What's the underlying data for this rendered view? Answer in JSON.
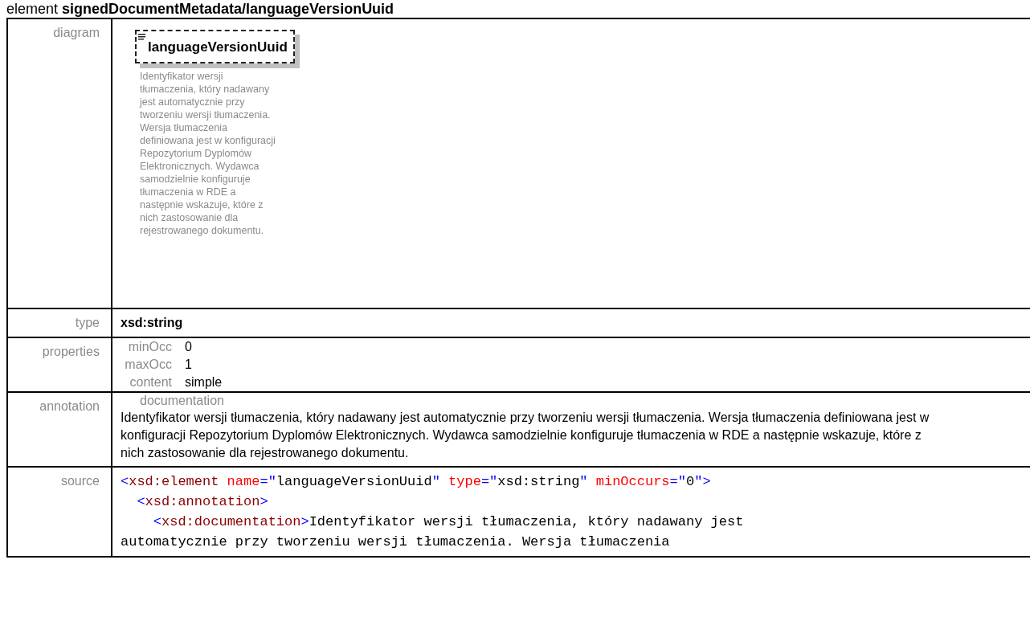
{
  "heading": {
    "prefix": "element",
    "path": "signedDocumentMetadata/languageVersionUuid"
  },
  "diagram": {
    "label": "diagram",
    "element_name": "languageVersionUuid",
    "description": "Identyfikator wersji tłumaczenia, który nadawany jest automatycznie przy tworzeniu wersji tłumaczenia. Wersja tłumaczenia definiowana jest w konfiguracji Repozytorium Dyplomów Elektronicznych. Wydawca samodzielnie konfiguruje tłumaczenia w RDE a następnie wskazuje, które z nich zastosowanie dla rejestrowanego dokumentu."
  },
  "type": {
    "label": "type",
    "value": "xsd:string"
  },
  "properties": {
    "label": "properties",
    "items": [
      {
        "name": "minOcc",
        "value": "0"
      },
      {
        "name": "maxOcc",
        "value": "1"
      },
      {
        "name": "content",
        "value": "simple"
      }
    ]
  },
  "annotation": {
    "label": "annotation",
    "heading": "documentation",
    "text": "Identyfikator wersji tłumaczenia, który nadawany jest automatycznie przy tworzeniu wersji tłumaczenia. Wersja tłumaczenia definiowana jest w konfiguracji Repozytorium Dyplomów Elektronicznych. Wydawca samodzielnie konfiguruje tłumaczenia w RDE a następnie wskazuje, które z nich zastosowanie dla rejestrowanego dokumentu."
  },
  "source": {
    "label": "source",
    "lines": [
      {
        "tokens": [
          {
            "kind": "punct",
            "text": "<"
          },
          {
            "kind": "tag",
            "text": "xsd:element"
          },
          {
            "kind": "attr",
            "text": " name"
          },
          {
            "kind": "punct",
            "text": "=\""
          },
          {
            "kind": "value",
            "text": "languageVersionUuid"
          },
          {
            "kind": "punct",
            "text": "\""
          },
          {
            "kind": "attr",
            "text": " type"
          },
          {
            "kind": "punct",
            "text": "=\""
          },
          {
            "kind": "value",
            "text": "xsd:string"
          },
          {
            "kind": "punct",
            "text": "\""
          },
          {
            "kind": "attr",
            "text": " minOccurs"
          },
          {
            "kind": "punct",
            "text": "=\""
          },
          {
            "kind": "value",
            "text": "0"
          },
          {
            "kind": "punct",
            "text": "\">"
          }
        ]
      },
      {
        "tokens": [
          {
            "kind": "punct",
            "text": "  <"
          },
          {
            "kind": "tag",
            "text": "xsd:annotation"
          },
          {
            "kind": "punct",
            "text": ">"
          }
        ]
      },
      {
        "tokens": [
          {
            "kind": "punct",
            "text": "    <"
          },
          {
            "kind": "tag",
            "text": "xsd:documentation"
          },
          {
            "kind": "punct",
            "text": ">"
          },
          {
            "kind": "value",
            "text": "Identyfikator wersji tłumaczenia, który nadawany jest"
          }
        ]
      },
      {
        "tokens": [
          {
            "kind": "value",
            "text": "automatycznie przy tworzeniu wersji tłumaczenia. Wersja tłumaczenia"
          }
        ]
      }
    ]
  }
}
